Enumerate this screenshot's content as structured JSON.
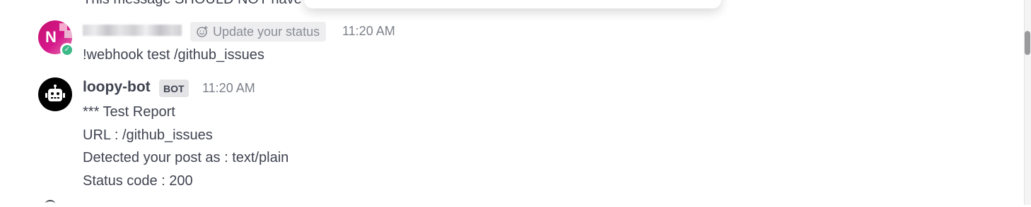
{
  "previous_post": {
    "text": "This message SHOULD NOT have created a thread"
  },
  "user_post": {
    "avatar_initial": "N",
    "status_button_label": "Update your status",
    "time": "11:20 AM",
    "message": "!webhook test /github_issues",
    "status_color": "#3db887",
    "avatar_color": "#c4126f"
  },
  "bot_post": {
    "name": "loopy-bot",
    "tag": "BOT",
    "time": "11:20 AM",
    "lines": [
      "*** Test Report",
      "URL : /github_issues",
      "Detected your post as : text/plain",
      "Status code : 200"
    ]
  }
}
